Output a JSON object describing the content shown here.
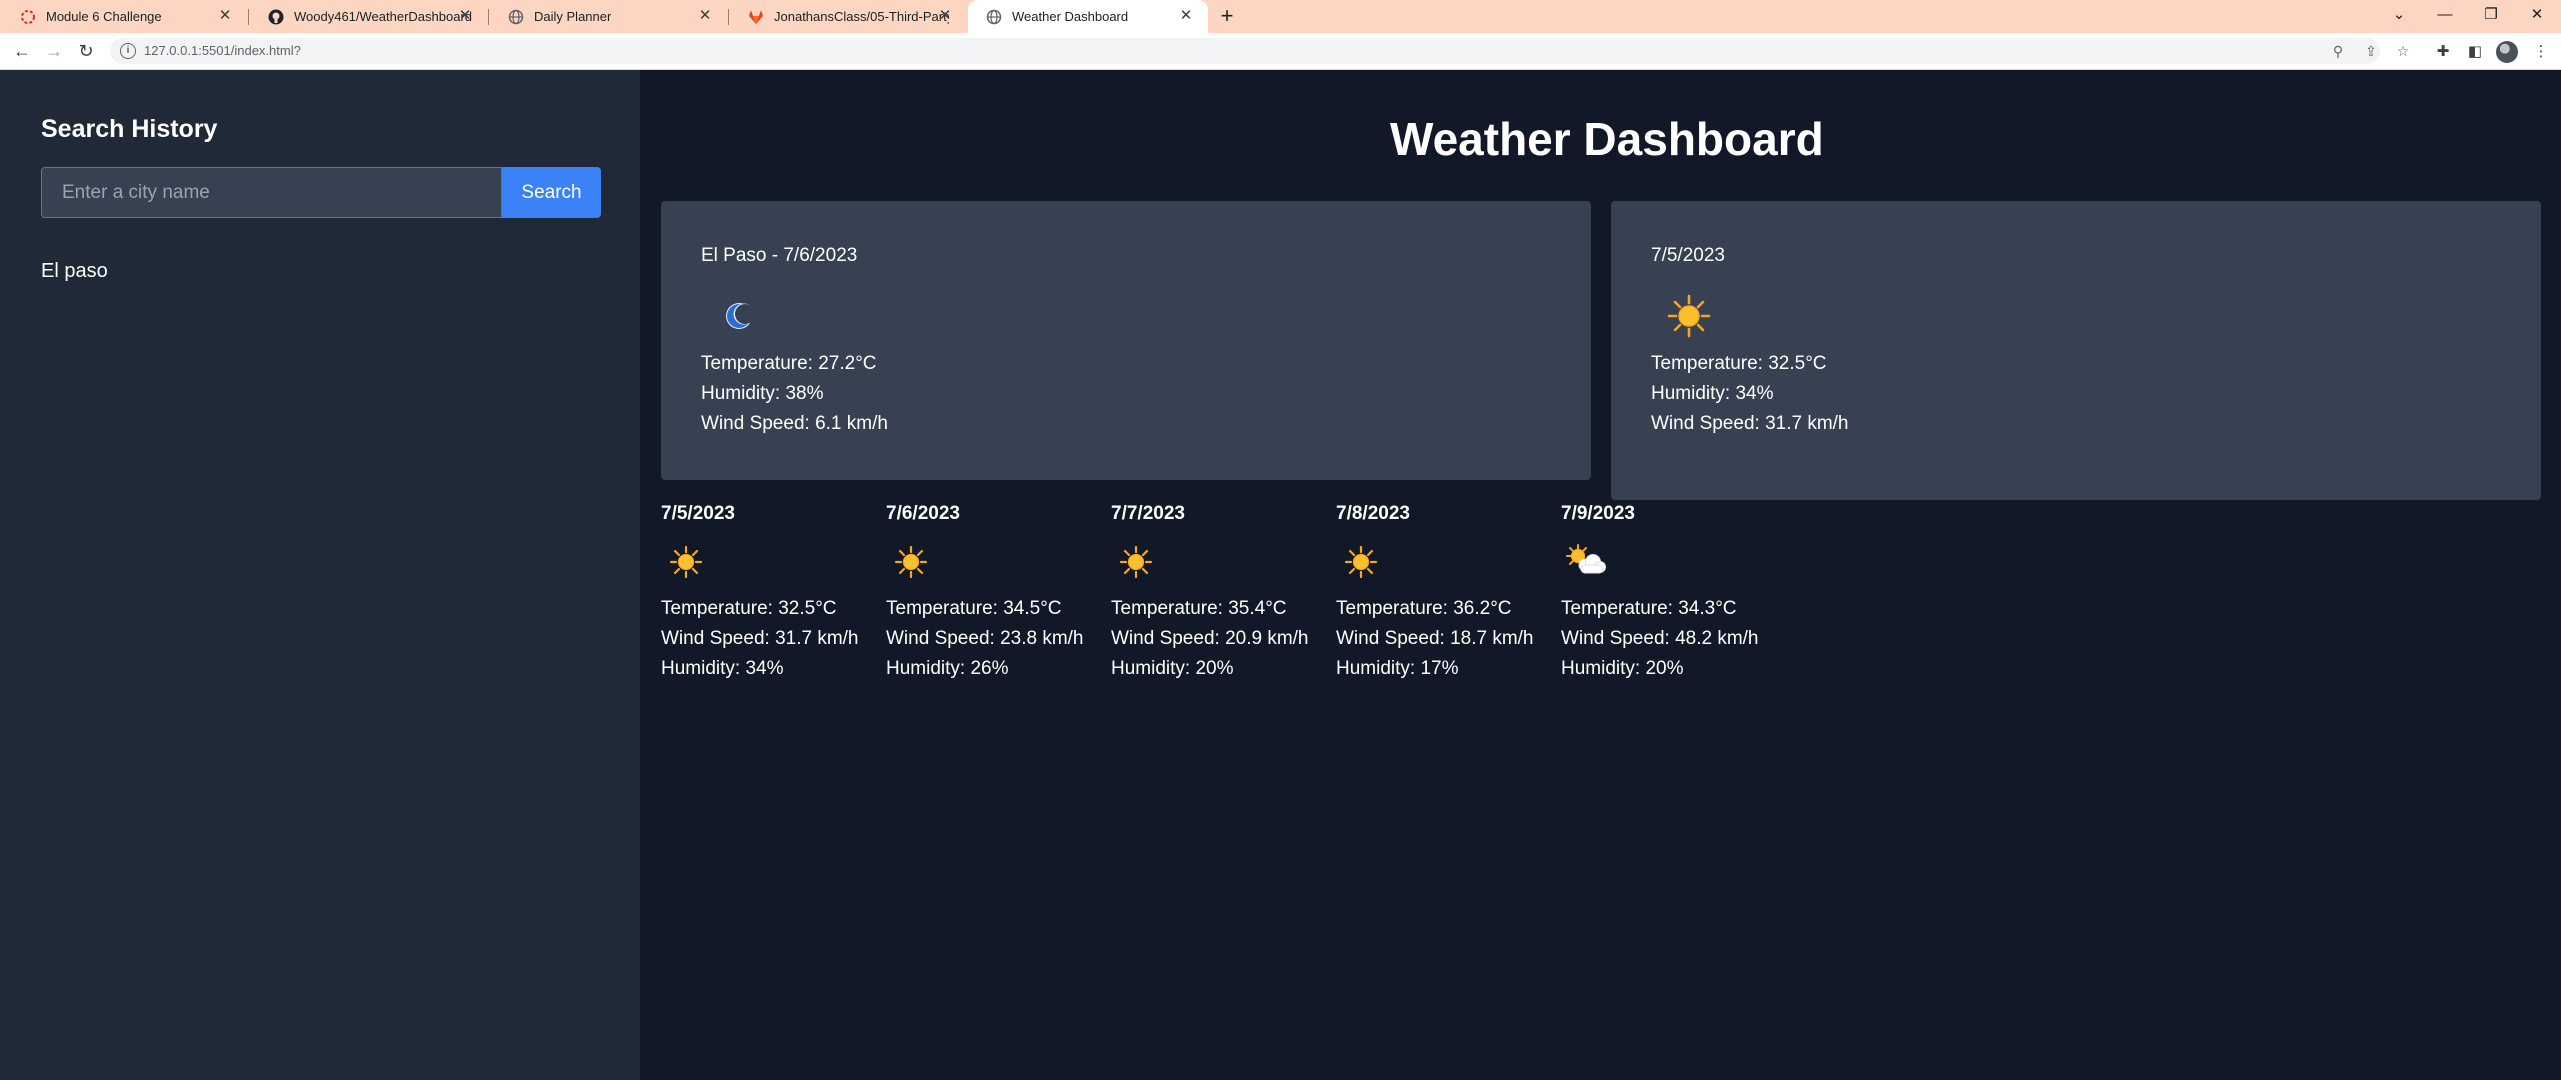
{
  "browser": {
    "tabs": [
      {
        "label": "Module 6 Challenge",
        "icon": "loading-icon"
      },
      {
        "label": "Woody461/WeatherDashboard",
        "icon": "github-icon"
      },
      {
        "label": "Daily Planner",
        "icon": "globe-icon"
      },
      {
        "label": "JonathansClass/05-Third-Party-A",
        "icon": "gitlab-icon"
      },
      {
        "label": "Weather Dashboard",
        "icon": "globe-icon",
        "active": true
      }
    ],
    "url": "127.0.0.1:5501/index.html?"
  },
  "sidebar": {
    "title": "Search History",
    "search_placeholder": "Enter a city name",
    "search_button": "Search",
    "history": [
      "El paso"
    ]
  },
  "main": {
    "title": "Weather Dashboard",
    "current": {
      "heading": "El Paso - 7/6/2023",
      "icon": "moon-icon",
      "temperature": "Temperature: 27.2°C",
      "humidity": "Humidity: 38%",
      "wind": "Wind Speed: 6.1 km/h"
    },
    "today": {
      "heading": "7/5/2023",
      "icon": "sun-icon",
      "temperature": "Temperature: 32.5°C",
      "humidity": "Humidity: 34%",
      "wind": "Wind Speed: 31.7 km/h"
    },
    "forecast": [
      {
        "date": "7/5/2023",
        "icon": "sun-icon",
        "temperature": "Temperature: 32.5°C",
        "wind": "Wind Speed: 31.7 km/h",
        "humidity": "Humidity: 34%"
      },
      {
        "date": "7/6/2023",
        "icon": "sun-icon",
        "temperature": "Temperature: 34.5°C",
        "wind": "Wind Speed: 23.8 km/h",
        "humidity": "Humidity: 26%"
      },
      {
        "date": "7/7/2023",
        "icon": "sun-icon",
        "temperature": "Temperature: 35.4°C",
        "wind": "Wind Speed: 20.9 km/h",
        "humidity": "Humidity: 20%"
      },
      {
        "date": "7/8/2023",
        "icon": "sun-icon",
        "temperature": "Temperature: 36.2°C",
        "wind": "Wind Speed: 18.7 km/h",
        "humidity": "Humidity: 17%"
      },
      {
        "date": "7/9/2023",
        "icon": "partly-cloudy-icon",
        "temperature": "Temperature: 34.3°C",
        "wind": "Wind Speed: 48.2 km/h",
        "humidity": "Humidity: 20%"
      }
    ]
  },
  "colors": {
    "page_bg": "#111827",
    "sidebar_bg": "#1f2937",
    "card_bg": "#374151",
    "accent": "#3b82f6",
    "tabbar_bg": "#fcd6c3"
  }
}
